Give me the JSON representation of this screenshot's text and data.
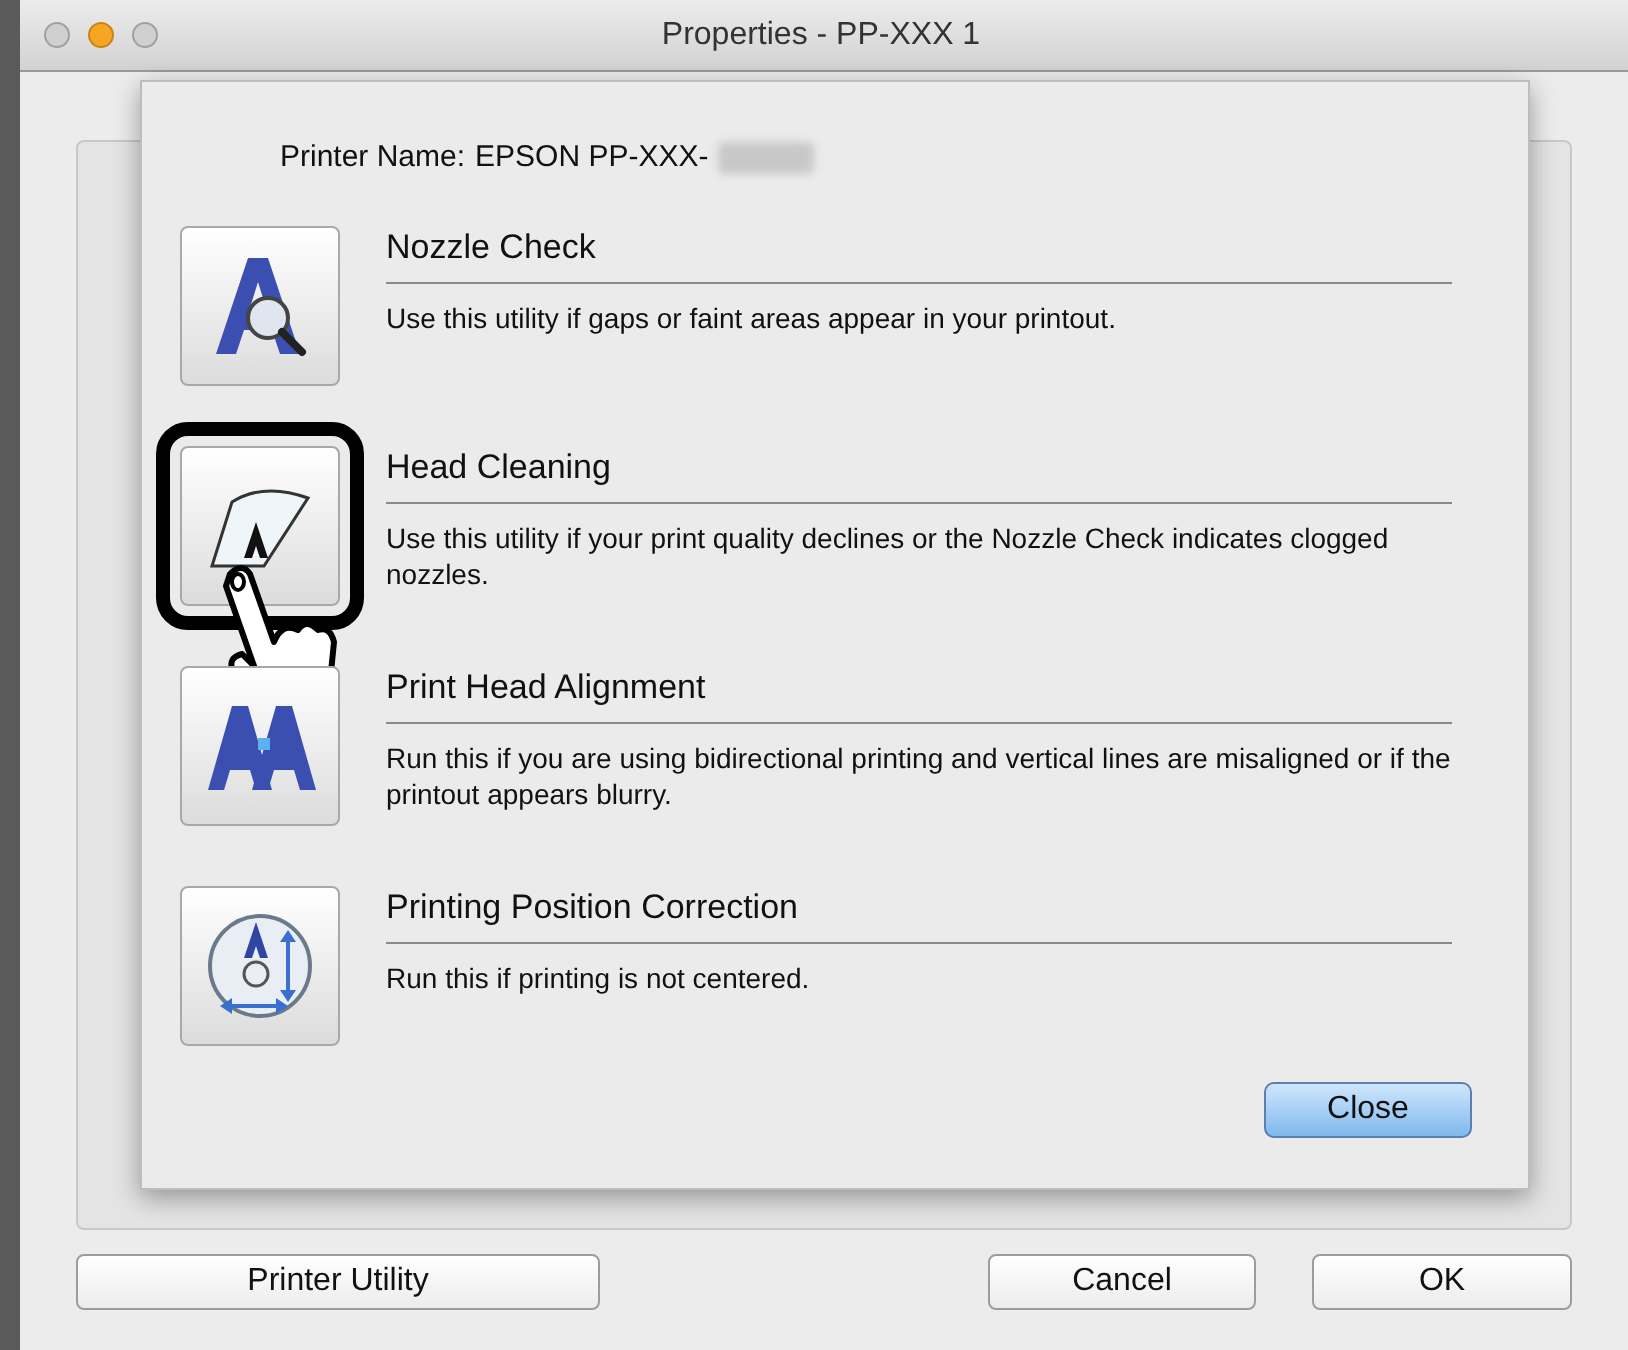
{
  "window": {
    "title": "Properties - PP-XXX 1"
  },
  "sheet": {
    "printer_name_label": "Printer Name:",
    "printer_name_value": "EPSON PP-XXX-",
    "utilities": [
      {
        "kind": "nozzle",
        "title": "Nozzle Check",
        "description": "Use this utility if gaps or faint areas appear in your printout.",
        "selected": false
      },
      {
        "kind": "cleaning",
        "title": "Head Cleaning",
        "description": "Use this utility if your print quality declines or the Nozzle Check indicates clogged nozzles.",
        "selected": true
      },
      {
        "kind": "alignment",
        "title": "Print Head Alignment",
        "description": "Run this if you are using bidirectional printing and vertical lines are misaligned or if the printout appears blurry.",
        "selected": false
      },
      {
        "kind": "position",
        "title": "Printing Position Correction",
        "description": "Run this if printing is not centered.",
        "selected": false
      }
    ],
    "close_button": "Close"
  },
  "buttons": [
    {
      "label": "Printer Utility"
    },
    {
      "label": "Cancel"
    },
    {
      "label": "OK"
    }
  ]
}
